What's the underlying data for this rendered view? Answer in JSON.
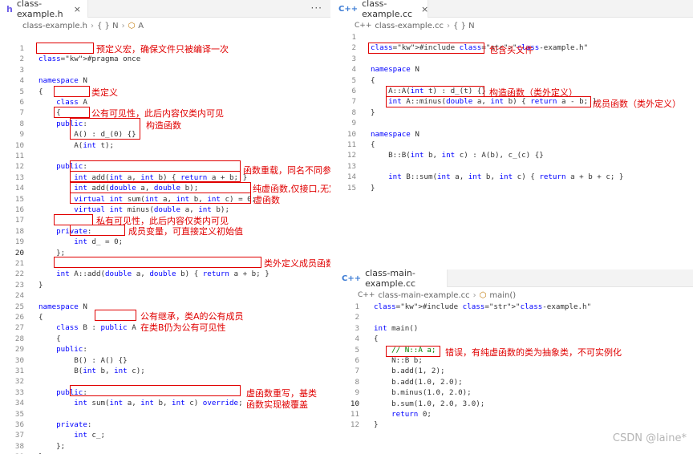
{
  "left": {
    "tab": "class-example.h",
    "tab_icon": "h",
    "crumbs": [
      "class-example.h",
      "{ } N",
      "A"
    ],
    "lines": [
      {
        "n": "1",
        "t": ""
      },
      {
        "n": "2",
        "t": "#pragma once"
      },
      {
        "n": "3",
        "t": ""
      },
      {
        "n": "4",
        "t": "namespace N"
      },
      {
        "n": "5",
        "t": "{"
      },
      {
        "n": "6",
        "t": "    class A"
      },
      {
        "n": "7",
        "t": "    {"
      },
      {
        "n": "8",
        "t": "    public:"
      },
      {
        "n": "9",
        "t": "        A() : d_(0) {}"
      },
      {
        "n": "10",
        "t": "        A(int t);"
      },
      {
        "n": "11",
        "t": ""
      },
      {
        "n": "12",
        "t": "    public:"
      },
      {
        "n": "13",
        "t": "        int add(int a, int b) { return a + b; }"
      },
      {
        "n": "14",
        "t": "        int add(double a, double b);"
      },
      {
        "n": "15",
        "t": "        virtual int sum(int a, int b, int c) = 0;"
      },
      {
        "n": "16",
        "t": "        virtual int minus(double a, int b);"
      },
      {
        "n": "17",
        "t": ""
      },
      {
        "n": "18",
        "t": "    private:"
      },
      {
        "n": "19",
        "t": "        int d_ = 0;"
      },
      {
        "n": "20",
        "t": "    };"
      },
      {
        "n": "21",
        "t": ""
      },
      {
        "n": "22",
        "t": "    int A::add(double a, double b) { return a + b; }"
      },
      {
        "n": "23",
        "t": "}"
      },
      {
        "n": "24",
        "t": ""
      },
      {
        "n": "25",
        "t": "namespace N"
      },
      {
        "n": "26",
        "t": "{"
      },
      {
        "n": "27",
        "t": "    class B : public A"
      },
      {
        "n": "28",
        "t": "    {"
      },
      {
        "n": "29",
        "t": "    public:"
      },
      {
        "n": "30",
        "t": "        B() : A() {}"
      },
      {
        "n": "31",
        "t": "        B(int b, int c);"
      },
      {
        "n": "32",
        "t": ""
      },
      {
        "n": "33",
        "t": "    public:"
      },
      {
        "n": "34",
        "t": "        int sum(int a, int b, int c) override;"
      },
      {
        "n": "35",
        "t": ""
      },
      {
        "n": "36",
        "t": "    private:"
      },
      {
        "n": "37",
        "t": "        int c_;"
      },
      {
        "n": "38",
        "t": "    };"
      },
      {
        "n": "39",
        "t": "}"
      }
    ],
    "notes": {
      "pragma": "预定义宏，确保文件只被编译一次",
      "class_def": "类定义",
      "public_vis": "公有可见性，此后内容仅类内可见",
      "ctor": "构造函数",
      "overload": "函数重载，同名不同参数",
      "pure_virtual": "纯虚函数,仅接口,无定义",
      "virtual": "虚函数",
      "private_vis": "私有可见性，此后内容仅类内可见",
      "member_var": "成员变量，可直接定义初始值",
      "outside_def": "类外定义成员函数",
      "inherit_1": "公有继承，类A的公有成员",
      "inherit_2": "在类B仍为公有可见性",
      "override_1": "虚函数重写，基类",
      "override_2": "函数实现被覆盖"
    }
  },
  "right_top": {
    "tab": "class-example.cc",
    "tab_icon": "C++",
    "crumbs": [
      "class-example.cc",
      "{ } N"
    ],
    "lines": [
      {
        "n": "1",
        "t": ""
      },
      {
        "n": "2",
        "t": "#include \"class-example.h\""
      },
      {
        "n": "3",
        "t": ""
      },
      {
        "n": "4",
        "t": "namespace N"
      },
      {
        "n": "5",
        "t": "{"
      },
      {
        "n": "6",
        "t": "    A::A(int t) : d_(t) {}"
      },
      {
        "n": "7",
        "t": "    int A::minus(double a, int b) { return a - b; }"
      },
      {
        "n": "8",
        "t": "}"
      },
      {
        "n": "9",
        "t": ""
      },
      {
        "n": "10",
        "t": "namespace N"
      },
      {
        "n": "11",
        "t": "{"
      },
      {
        "n": "12",
        "t": "    B::B(int b, int c) : A(b), c_(c) {}"
      },
      {
        "n": "13",
        "t": ""
      },
      {
        "n": "14",
        "t": "    int B::sum(int a, int b, int c) { return a + b + c; }"
      },
      {
        "n": "15",
        "t": "}"
      }
    ],
    "notes": {
      "include": "包含头文件",
      "ctor_out": "构造函数（类外定义）",
      "member_out": "成员函数（类外定义）"
    }
  },
  "right_bottom": {
    "tab": "class-main-example.cc",
    "tab_icon": "C++",
    "crumbs": [
      "class-main-example.cc",
      "main()"
    ],
    "lines": [
      {
        "n": "1",
        "t": "#include \"class-example.h\""
      },
      {
        "n": "2",
        "t": ""
      },
      {
        "n": "3",
        "t": "int main()"
      },
      {
        "n": "4",
        "t": "{"
      },
      {
        "n": "5",
        "t": "    // N::A a;"
      },
      {
        "n": "6",
        "t": "    N::B b;"
      },
      {
        "n": "7",
        "t": "    b.add(1, 2);"
      },
      {
        "n": "8",
        "t": "    b.add(1.0, 2.0);"
      },
      {
        "n": "9",
        "t": "    b.minus(1.0, 2.0);"
      },
      {
        "n": "10",
        "t": "    b.sum(1.0, 2.0, 3.0);"
      },
      {
        "n": "11",
        "t": "    return 0;"
      },
      {
        "n": "12",
        "t": "}"
      }
    ],
    "notes": {
      "abstract": "错误，有纯虚函数的类为抽象类，不可实例化"
    }
  },
  "watermark": "CSDN @laine*"
}
